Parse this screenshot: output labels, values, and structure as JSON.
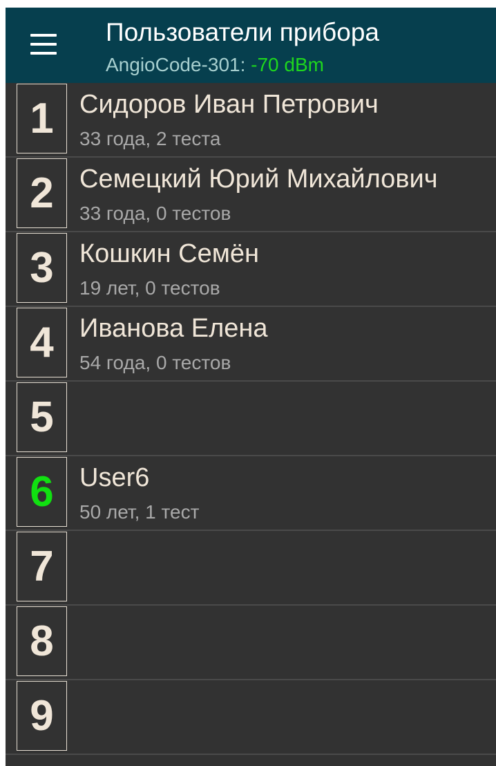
{
  "header": {
    "title": "Пользователи прибора",
    "device": "AngioCode-301: ",
    "signal": "-70 dBm",
    "menu_icon": "hamburger-menu-icon"
  },
  "colors": {
    "appbar": "#063f4e",
    "background": "#323232",
    "signal_green": "#1ed61e",
    "active_number": "#11e011",
    "text_primary": "#f0e6d8",
    "text_secondary": "#a9a9a9"
  },
  "users": [
    {
      "number": "1",
      "name": "Сидоров Иван Петрович",
      "info": "33 года, 2 теста",
      "active": false
    },
    {
      "number": "2",
      "name": "Семецкий Юрий Михайлович",
      "info": "33 года, 0 тестов",
      "active": false
    },
    {
      "number": "3",
      "name": "Кошкин Семён",
      "info": "19 лет, 0 тестов",
      "active": false
    },
    {
      "number": "4",
      "name": "Иванова Елена",
      "info": "54 года, 0 тестов",
      "active": false
    },
    {
      "number": "5",
      "name": "",
      "info": "",
      "active": false
    },
    {
      "number": "6",
      "name": "User6",
      "info": "50 лет, 1 тест",
      "active": true
    },
    {
      "number": "7",
      "name": "",
      "info": "",
      "active": false
    },
    {
      "number": "8",
      "name": "",
      "info": "",
      "active": false
    },
    {
      "number": "9",
      "name": "",
      "info": "",
      "active": false
    }
  ]
}
